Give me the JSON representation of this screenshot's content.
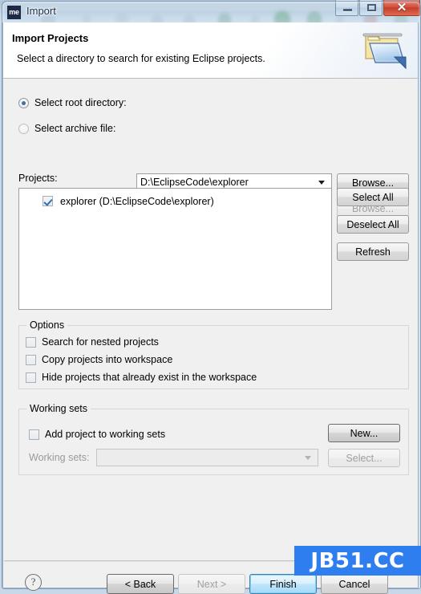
{
  "window": {
    "title": "Import",
    "app_icon_text": "me",
    "controls": {
      "minimize": "minimize-button",
      "maximize": "maximize-button",
      "close_glyph": "✕"
    }
  },
  "banner": {
    "title": "Import Projects",
    "subtitle": "Select a directory to search for existing Eclipse projects.",
    "icon": "import-folder-icon"
  },
  "source": {
    "root_directory": {
      "label": "Select root directory:",
      "value": "D:\\EclipseCode\\explorer",
      "selected": true,
      "browse_label": "Browse..."
    },
    "archive_file": {
      "label": "Select archive file:",
      "value": "",
      "selected": false,
      "browse_label": "Browse..."
    }
  },
  "projects": {
    "label": "Projects:",
    "items": [
      {
        "label": "explorer (D:\\EclipseCode\\explorer)",
        "checked": true
      }
    ],
    "buttons": {
      "select_all": "Select All",
      "deselect_all": "Deselect All",
      "refresh": "Refresh"
    }
  },
  "options": {
    "title": "Options",
    "items": [
      {
        "label": "Search for nested projects",
        "checked": false
      },
      {
        "label": "Copy projects into workspace",
        "checked": false
      },
      {
        "label": "Hide projects that already exist in the workspace",
        "checked": false
      }
    ]
  },
  "working_sets": {
    "title": "Working sets",
    "add_checkbox": {
      "label": "Add project to working sets",
      "checked": false
    },
    "new_button": "New...",
    "combo_label": "Working sets:",
    "combo_value": "",
    "select_button": "Select..."
  },
  "footer": {
    "help": "?",
    "back": "< Back",
    "next": "Next >",
    "finish": "Finish",
    "cancel": "Cancel"
  },
  "watermark": {
    "text": "JB51.CC",
    "color": "#2f7ef0"
  }
}
